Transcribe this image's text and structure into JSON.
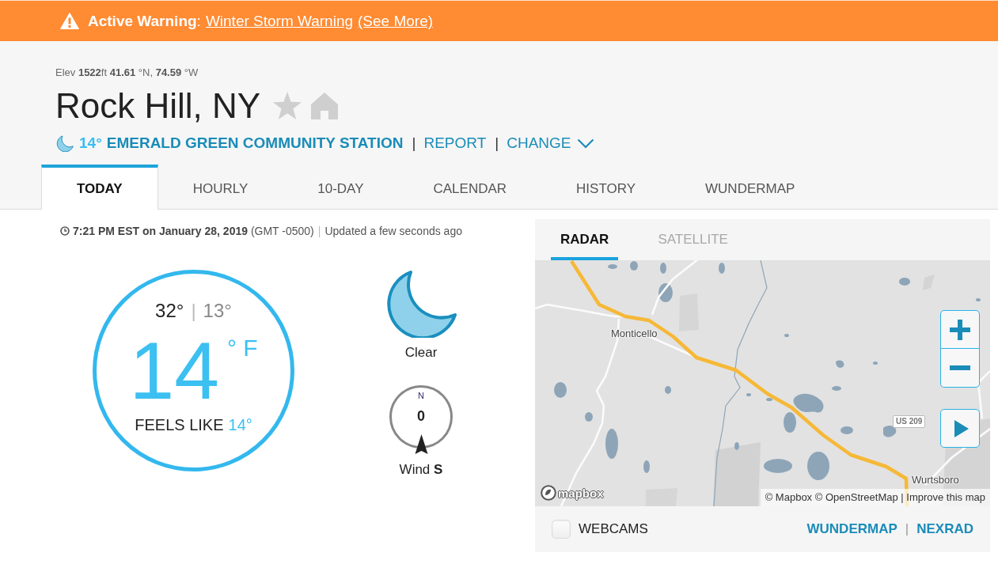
{
  "alert": {
    "label": "**Active Warning**:",
    "link": "Winter Storm Warning",
    "more": "(See More)"
  },
  "location": {
    "coordinates": "Elev **1522**ft **41.61** °N, **74.59** °W",
    "name": "Rock Hill, NY",
    "favorite": false,
    "home": false
  },
  "station": {
    "temperature": "14°",
    "name": "EMERALD GREEN COMMUNITY STATION",
    "links": [
      {
        "separator": "|",
        "label": "REPORT",
        "kind": "link"
      },
      {
        "separator": "|",
        "label": "CHANGE",
        "kind": "dropdown"
      }
    ]
  },
  "tabs": [
    {
      "label": "TODAY",
      "selected": true
    },
    {
      "label": "HOURLY",
      "selected": false
    },
    {
      "label": "10-DAY",
      "selected": false
    },
    {
      "label": "CALENDAR",
      "selected": false
    },
    {
      "label": "HISTORY",
      "selected": false
    },
    {
      "label": "WUNDERMAP",
      "selected": false
    }
  ],
  "observation": {
    "time": "**7:21 PM EST on January 28, 2019** (GMT -0500)",
    "separator": "|",
    "updated": "Updated a few seconds ago"
  },
  "temperature": {
    "high": "32°",
    "separator": "|",
    "low": "13°",
    "current": "14",
    "unit": "° F",
    "feels_like_label": "FEELS LIKE",
    "feels_like": "14°"
  },
  "sky": {
    "condition": "Clear"
  },
  "wind": {
    "north": "N",
    "speed": "0",
    "label": "Wind **S**"
  },
  "map_panel": {
    "tabs": [
      {
        "label": "RADAR",
        "selected": true
      },
      {
        "label": "SATELLITE",
        "selected": false
      }
    ],
    "places": [
      {
        "name": "Monticello"
      },
      {
        "name": "Wurtsboro"
      }
    ],
    "shield": "US 209",
    "logo": "mapbox",
    "attribution": "© Mapbox © OpenStreetMap | Improve this map",
    "webcams": {
      "label": "WEBCAMS",
      "checked": false
    },
    "links": [
      {
        "label": "WUNDERMAP"
      },
      {
        "label": "NEXRAD"
      }
    ],
    "link_separator": "|"
  }
}
